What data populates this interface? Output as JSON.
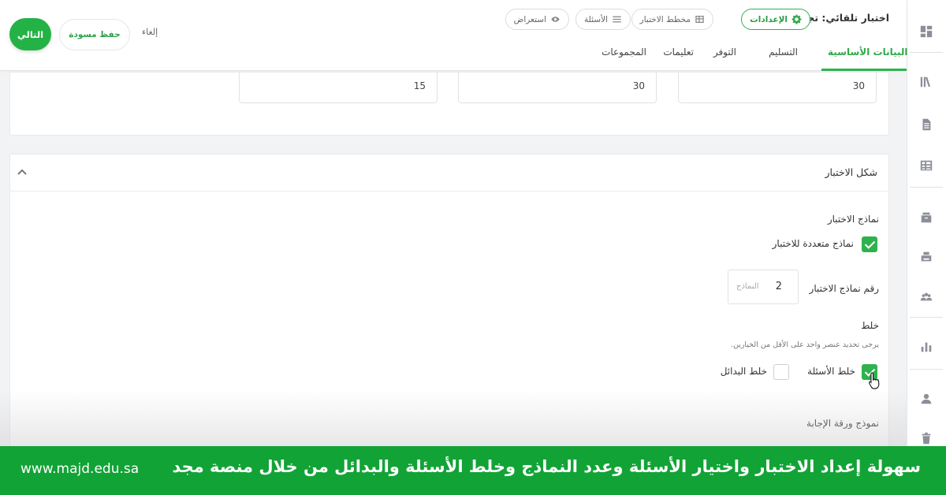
{
  "header": {
    "quiz_title": "اختبار تلقائي: تجريبي",
    "pills": {
      "settings": "الإعدادات",
      "outline": "مخطط الاختبار",
      "questions": "الأسئلة",
      "preview": "استعراض"
    },
    "tabs": {
      "basic": "البيانات الأساسية",
      "delivery": "التسليم",
      "availability": "التوفر",
      "instructions": "تعليمات",
      "groups": "المجموعات"
    },
    "buttons": {
      "next": "التالي",
      "save_draft": "حفظ مسودة",
      "cancel": "إلغاء"
    }
  },
  "top_values": [
    "30",
    "30",
    "15"
  ],
  "section": {
    "title": "شكل الاختبار",
    "versions_label": "نماذج الاختبار",
    "multi_versions_label": "نماذج متعددة للاختبار",
    "multi_versions_checked": true,
    "versions_count_label": "رقم نماذج الاختبار",
    "versions_count_value": "2",
    "versions_count_placeholder": "النماذج",
    "shuffle_label": "خلط",
    "shuffle_hint": "يرجى تحديد عنصر واحد على الأقل من الخيارين.",
    "shuffle_questions_label": "خلط الأسئلة",
    "shuffle_questions_checked": true,
    "shuffle_options_label": "خلط البدائل",
    "shuffle_options_checked": false,
    "answer_sheet_label": "نموذج ورقة الإجابة"
  },
  "banner": {
    "text": "سهولة إعداد الاختبار واختيار الأسئلة وعدد النماذج وخلط الأسئلة والبدائل من خلال منصة مجد",
    "url": "www.majd.edu.sa"
  },
  "colors": {
    "accent": "#2fb24e",
    "banner": "#12a336"
  }
}
